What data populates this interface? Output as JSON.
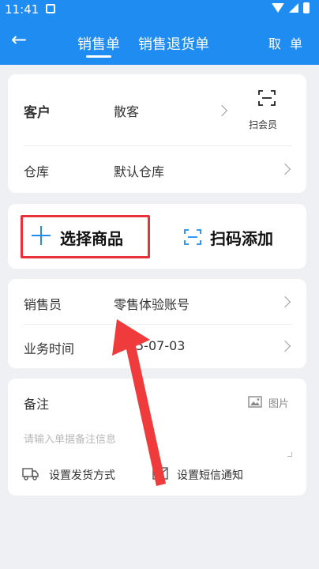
{
  "status_bar": {
    "time": "11:41"
  },
  "header": {
    "back_icon": "arrow-left-icon",
    "tabs": [
      {
        "label": "销售单",
        "active": true
      },
      {
        "label": "销售退货单",
        "active": false
      }
    ],
    "cancel_label": "取 单",
    "color": "#1e8cf0"
  },
  "form": {
    "customer": {
      "label": "客户",
      "value": "散客"
    },
    "scan_member": {
      "label": "扫会员",
      "icon": "scan-icon"
    },
    "warehouse": {
      "label": "仓库",
      "value": "默认仓库"
    }
  },
  "actions": {
    "select_goods": "选择商品",
    "scan_add": "扫码添加",
    "highlight_color": "#e8313a"
  },
  "sales": {
    "salesperson": {
      "label": "销售员",
      "value": "零售体验账号"
    },
    "business_time": {
      "label": "业务时间",
      "value": "5-07-03"
    }
  },
  "remark": {
    "label": "备注",
    "placeholder": "请输入单据备注信息",
    "image_label": "图片"
  },
  "options": {
    "shipping": "设置发货方式",
    "sms": "设置短信通知"
  }
}
